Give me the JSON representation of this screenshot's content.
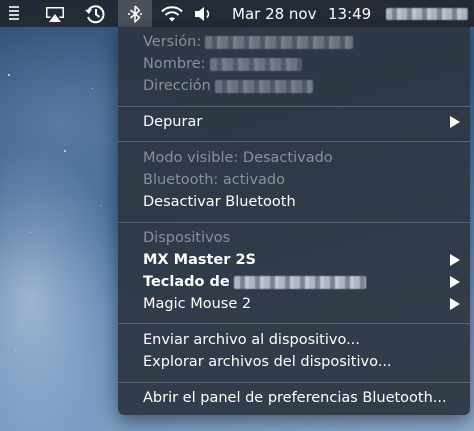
{
  "menubar": {
    "date": "Mar 28 nov",
    "time": "13:49"
  },
  "bluetooth_menu": {
    "version_label": "Versión:",
    "name_label": "Nombre:",
    "address_label": "Dirección",
    "debug_label": "Depurar",
    "visible_mode": "Modo visible: Desactivado",
    "bluetooth_status": "Bluetooth: activado",
    "disable_bluetooth": "Desactivar Bluetooth",
    "devices_header": "Dispositivos",
    "devices": [
      {
        "label": "MX Master 2S"
      },
      {
        "label": "Teclado de"
      },
      {
        "label": "Magic Mouse 2"
      }
    ],
    "send_file": "Enviar archivo al dispositivo...",
    "browse_files": "Explorar archivos del dispositivo...",
    "open_preferences": "Abrir el panel de preferencias Bluetooth..."
  },
  "icons": {
    "left_partial": "battery-list-icon",
    "airplay": "airplay-icon",
    "time_machine": "time-machine-icon",
    "bluetooth": "bluetooth-icon",
    "wifi": "wifi-icon",
    "volume": "volume-icon"
  }
}
